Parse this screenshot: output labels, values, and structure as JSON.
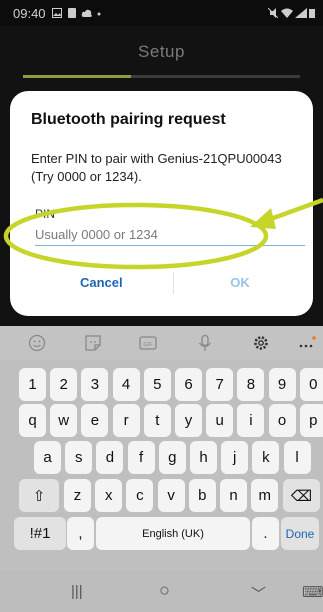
{
  "status_bar": {
    "time": "09:40"
  },
  "app": {
    "title": "Setup",
    "progress": 0.39
  },
  "dialog": {
    "title": "Bluetooth pairing request",
    "message": "Enter PIN to pair with Genius-21QPU00043 (Try 0000 or 1234).",
    "pin_label": "PIN",
    "pin_placeholder": "Usually 0000 or 1234",
    "cancel_label": "Cancel",
    "ok_label": "OK"
  },
  "annotation": {
    "color": "#c7d52a"
  },
  "keyboard": {
    "toolbar_icons": [
      "emoji-icon",
      "sticker-icon",
      "gif-icon",
      "microphone-icon",
      "settings-icon",
      "more-icon"
    ],
    "row1": [
      "1",
      "2",
      "3",
      "4",
      "5",
      "6",
      "7",
      "8",
      "9",
      "0"
    ],
    "row2": [
      "q",
      "w",
      "e",
      "r",
      "t",
      "y",
      "u",
      "i",
      "o",
      "p"
    ],
    "row3": [
      "a",
      "s",
      "d",
      "f",
      "g",
      "h",
      "j",
      "k",
      "l"
    ],
    "row4": [
      "z",
      "x",
      "c",
      "v",
      "b",
      "n",
      "m"
    ],
    "symbols_label": "!#1",
    "comma_label": ",",
    "space_label": "English (UK)",
    "period_label": ".",
    "done_label": "Done",
    "shift_icon": "⇧",
    "backspace_icon": "⌫"
  },
  "navbar": {
    "recent_icon": "|||",
    "home_icon": "○",
    "back_icon": "﹀",
    "keyboard_icon": "⌨"
  }
}
